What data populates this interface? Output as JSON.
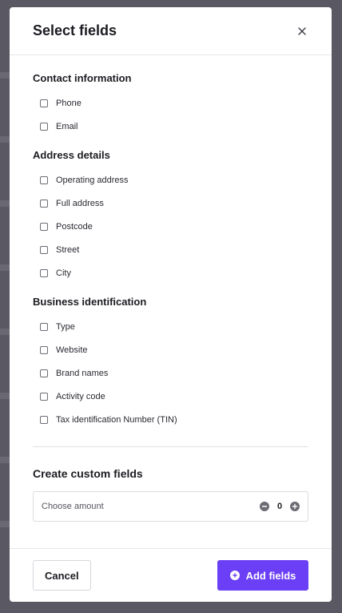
{
  "modal": {
    "title": "Select fields",
    "close_icon": "close-icon"
  },
  "sections": [
    {
      "title": "Contact information",
      "options": [
        "Phone",
        "Email"
      ]
    },
    {
      "title": "Address details",
      "options": [
        "Operating address",
        "Full address",
        "Postcode",
        "Street",
        "City"
      ]
    },
    {
      "title": "Business identification",
      "options": [
        "Type",
        "Website",
        "Brand names",
        "Activity code",
        "Tax identification Number (TIN)"
      ]
    }
  ],
  "custom": {
    "title": "Create custom fields",
    "amount_label": "Choose amount",
    "amount_value": "0"
  },
  "footer": {
    "cancel_label": "Cancel",
    "add_label": "Add fields"
  },
  "colors": {
    "accent": "#6b3ff5",
    "backdrop": "#5a5862"
  }
}
